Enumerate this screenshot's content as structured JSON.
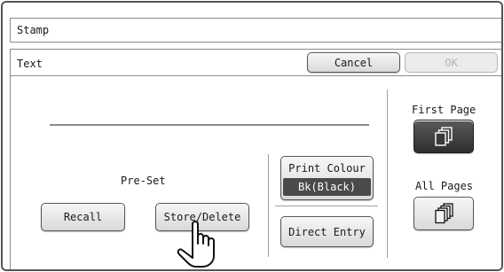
{
  "window": {
    "title": "Stamp"
  },
  "panel": {
    "label": "Text",
    "cancel_label": "Cancel",
    "ok_label": "OK"
  },
  "preset": {
    "label": "Pre-Set",
    "recall_label": "Recall",
    "store_delete_label": "Store/Delete"
  },
  "print_colour": {
    "label": "Print Colour",
    "value": "Bk(Black)"
  },
  "direct_entry_label": "Direct Entry",
  "pages": {
    "first_page_label": "First Page",
    "first_page_icon": "pages-stack-icon",
    "first_page_selected": true,
    "all_pages_label": "All Pages",
    "all_pages_icon": "pages-stack-icon"
  },
  "pointer_icon": "pointing-hand-icon",
  "colors": {
    "selected_button": "#3a3a3a",
    "colour_value_bg": "#4a4a4a",
    "disabled_text": "#b5b5b5"
  }
}
